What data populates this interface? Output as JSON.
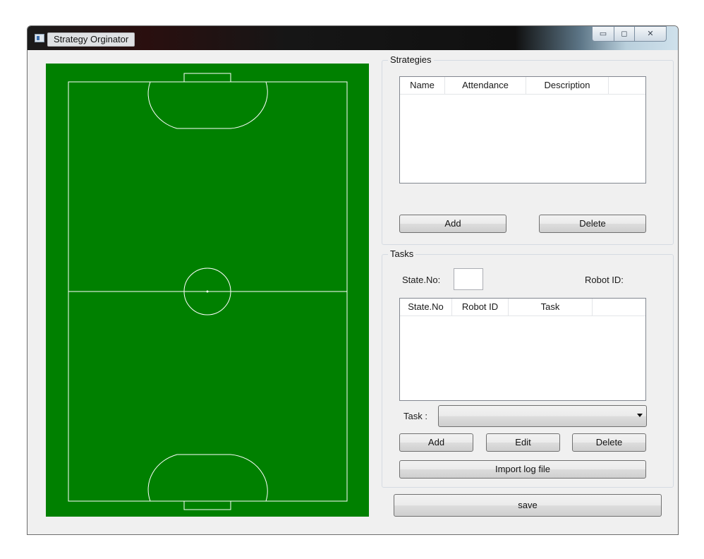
{
  "window": {
    "title": "Strategy Orginator"
  },
  "title_controls": {
    "minimize": "▭",
    "maximize": "◻",
    "close": "✕"
  },
  "field": {
    "color": "#008000",
    "line_color": "#ffffff"
  },
  "strategies": {
    "group_label": "Strategies",
    "columns": [
      "Name",
      "Attendance",
      "Description"
    ],
    "rows": [],
    "add_label": "Add",
    "delete_label": "Delete"
  },
  "tasks": {
    "group_label": "Tasks",
    "state_no_label": "State.No:",
    "state_no_value": "",
    "robot_id_label": "Robot ID:",
    "columns": [
      "State.No",
      "Robot ID",
      "Task"
    ],
    "rows": [],
    "task_label": "Task :",
    "task_selected": "",
    "add_label": "Add",
    "edit_label": "Edit",
    "delete_label": "Delete",
    "import_label": "Import log file"
  },
  "save_label": "save"
}
